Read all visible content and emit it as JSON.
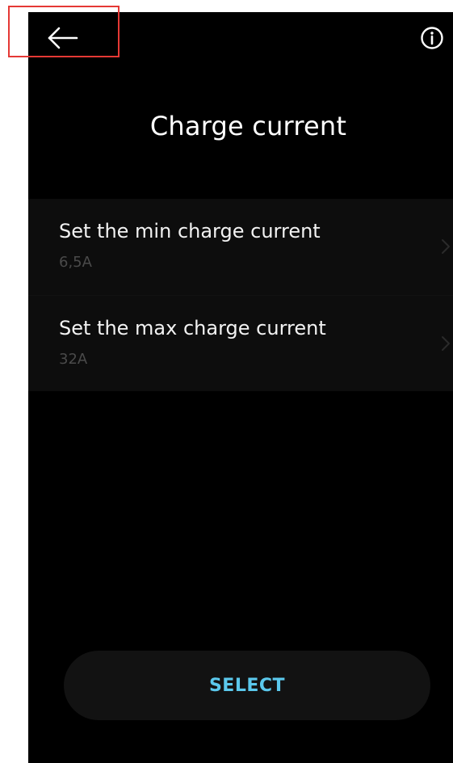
{
  "header": {
    "title": "Charge current",
    "back_icon": "arrow-left-icon",
    "info_icon": "info-icon"
  },
  "settings": [
    {
      "label": "Set the min charge current",
      "value": "6,5A"
    },
    {
      "label": "Set the max charge current",
      "value": "32A"
    }
  ],
  "footer": {
    "select_label": "SELECT"
  },
  "colors": {
    "background": "#000000",
    "row_background": "#0d0d0d",
    "accent": "#5bc8ec",
    "highlight": "#e53935"
  }
}
